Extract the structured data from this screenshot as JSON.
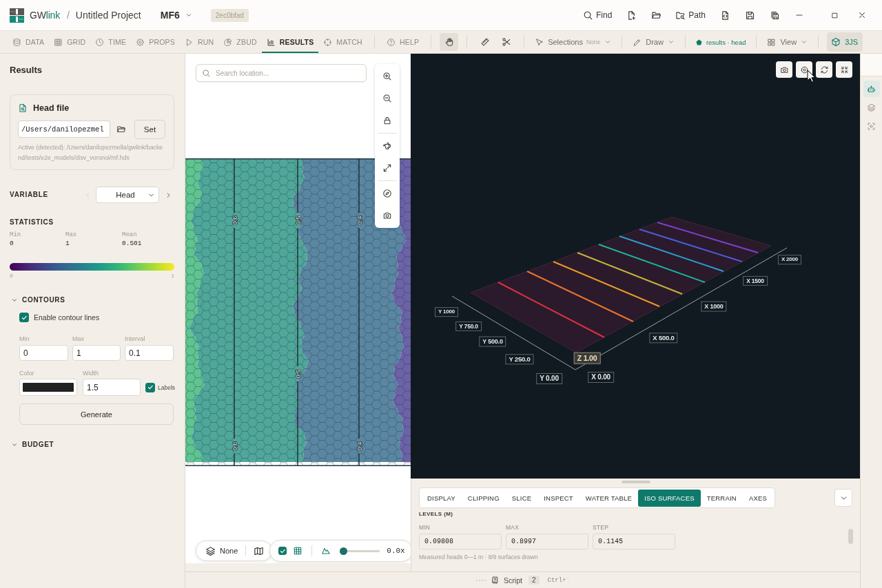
{
  "title_bar": {
    "app_name": [
      {
        "text": "GW",
        "accent": false
      },
      {
        "text": "link",
        "accent": true
      }
    ],
    "separator": "/",
    "project": "Untitled Project",
    "engine": "MF6",
    "badge": "2ec0bfad",
    "actions": [
      {
        "kind": "search",
        "label": "Find"
      },
      {
        "kind": "file-plus"
      },
      {
        "kind": "folder"
      },
      {
        "kind": "folder-search",
        "label": "Path"
      },
      {
        "kind": "file-code"
      },
      {
        "kind": "save"
      },
      {
        "kind": "save-all"
      }
    ]
  },
  "toolbar": {
    "tabs": [
      {
        "kind": "database",
        "label": "DATA",
        "selected": false
      },
      {
        "kind": "grid",
        "label": "GRID",
        "selected": false
      },
      {
        "kind": "clock",
        "label": "TIME",
        "selected": false
      },
      {
        "kind": "gear",
        "label": "PROPS",
        "selected": false
      },
      {
        "kind": "play",
        "label": "RUN",
        "selected": false
      },
      {
        "kind": "pie",
        "label": "ZBUD",
        "selected": false
      },
      {
        "kind": "bars",
        "label": "RESULTS",
        "selected": true
      },
      {
        "kind": "crosshair",
        "label": "MATCH",
        "selected": false
      }
    ],
    "help": {
      "label": "HELP"
    },
    "tool_groups": [
      [
        {
          "kind": "hand",
          "active": true
        }
      ],
      [
        {
          "kind": "ruler",
          "active": false
        },
        {
          "kind": "scissors",
          "active": false
        }
      ]
    ],
    "selections": {
      "label": "Selections",
      "value": "None"
    },
    "draw": {
      "label": "Draw"
    },
    "layer_chip": {
      "label": "results · head"
    },
    "view": {
      "label": "View"
    },
    "renderer": {
      "label": "3JS",
      "active": true
    }
  },
  "left_panel": {
    "title": "Results",
    "head_file": {
      "title": "Head file",
      "value": "/Users/danilopezmel",
      "button": "Set",
      "hint": "Active (detected): /Users/danilopezmella/gwlink/backend/tests/e2e_models/disv_voronoi/mf.hds"
    },
    "variable": {
      "label": "VARIABLE",
      "value": "Head",
      "prev_disabled": true,
      "next_disabled": false
    },
    "statistics": {
      "title": "STATISTICS",
      "items": [
        {
          "label": "Min",
          "value": "0"
        },
        {
          "label": "Max",
          "value": "1"
        },
        {
          "label": "Mean",
          "value": "0.501"
        }
      ],
      "scale": [
        "0",
        "1"
      ]
    },
    "contours": {
      "title": "CONTOURS",
      "enable": {
        "label": "Enable contour lines",
        "checked": true
      },
      "fields": [
        {
          "label": "Min",
          "value": "0"
        },
        {
          "label": "Max",
          "value": "1"
        },
        {
          "label": "Interval",
          "value": "0.1"
        }
      ],
      "color": {
        "label": "Color",
        "color": "#222222"
      },
      "width": {
        "label": "Width",
        "value": "1.5"
      },
      "labels": {
        "label": "Labels",
        "checked": true
      },
      "button": "Generate"
    },
    "budget": {
      "title": "BUDGET"
    }
  },
  "map": {
    "search": {
      "placeholder": "Search location..."
    },
    "tool_groups": [
      [
        {
          "kind": "zoom-in"
        },
        {
          "kind": "zoom-out"
        },
        {
          "kind": "lock"
        }
      ],
      [
        {
          "kind": "orbit"
        },
        {
          "kind": "expand"
        }
      ],
      [
        {
          "kind": "compass"
        },
        {
          "kind": "camera"
        }
      ]
    ],
    "contour_lines": [
      {
        "labels": [
          "0.6",
          "0.6"
        ]
      },
      {
        "labels": [
          "0.5",
          "0.5"
        ]
      },
      {
        "labels": [
          "0.4",
          "0.4"
        ]
      }
    ],
    "basemap": {
      "label": "None"
    },
    "mesh_overlay": {
      "checked": true
    },
    "exaggeration": {
      "level": 0,
      "reading": "0.0x"
    }
  },
  "scene": {
    "view_tools": [
      {
        "kind": "camera"
      },
      {
        "kind": "target"
      },
      {
        "kind": "refresh"
      },
      {
        "kind": "collapse"
      }
    ],
    "iso_lines": [
      {
        "color": "#d9323f"
      },
      {
        "color": "#e8742c"
      },
      {
        "color": "#e89a24"
      },
      {
        "color": "#c2b43c"
      },
      {
        "color": "#1fb39a"
      },
      {
        "color": "#2a9fd0"
      },
      {
        "color": "#4a5ed6"
      },
      {
        "color": "#7a42cf"
      }
    ],
    "y_ticks": [
      "Y 0.00",
      "Y 250.0",
      "Y 500.0",
      "Y 750.0",
      "Y 1000"
    ],
    "x_ticks": [
      "X 0.00",
      "X 500.0",
      "X 1000",
      "X 1500",
      "X 2000"
    ],
    "z_tick": "Z 1.00"
  },
  "bottom_panel": {
    "tabs": [
      {
        "label": "DISPLAY",
        "selected": false
      },
      {
        "label": "CLIPPING",
        "selected": false
      },
      {
        "label": "SLICE",
        "selected": false
      },
      {
        "label": "INSPECT",
        "selected": false
      },
      {
        "label": "WATER TABLE",
        "selected": false
      },
      {
        "label": "ISO SURFACES",
        "selected": true
      },
      {
        "label": "TERRAIN",
        "selected": false
      },
      {
        "label": "AXES",
        "selected": false
      }
    ],
    "section_label": "LEVELS (M)",
    "fields": [
      {
        "label": "MIN",
        "value": "0.09808"
      },
      {
        "label": "MAX",
        "value": "0.8997"
      },
      {
        "label": "STEP",
        "value": "0.1145"
      }
    ],
    "hint": "Measured heads 0—1 m · 8/8 surfaces drawn"
  },
  "right_rail": [
    {
      "kind": "bot",
      "selected": true
    },
    {
      "kind": "layers",
      "selected": false
    },
    {
      "kind": "focus",
      "selected": false
    }
  ],
  "status_bar": {
    "script": {
      "label": "Script",
      "count": "2"
    },
    "shortcut": "Ctrl+`"
  }
}
